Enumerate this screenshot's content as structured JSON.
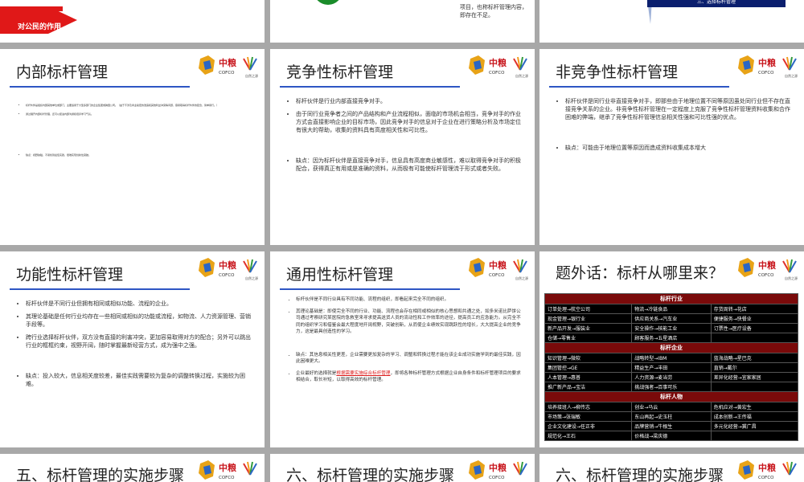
{
  "top_row": {
    "left_caption": "对公民的作用",
    "middle_text": "项目，也称标杆管理内容，即存在不足。",
    "right_box_text": "三、选择标杆管理"
  },
  "brand": {
    "cn": "中粮",
    "en": "COFCO",
    "sub": "自然之源"
  },
  "slides": {
    "s1": {
      "title": "内部标杆管理",
      "items": [
        "标杆伙伴是组织内部其他单位或部门，主要适用于大型多部门的企业集团或跨国公司。（由于不涉及商业秘密的泄露和其他利益冲突等问题，容易取得标杆伙伴的配合，简单易行。）",
        "通过展开内部标杆管理，还可以促进内部沟通和培养学习气氛。"
      ],
      "items2": [
        "缺点：视野狭隘，不易找到最佳实践，很难实现创新性突破。"
      ]
    },
    "s2": {
      "title": "竞争性标杆管理",
      "items": [
        "标杆伙伴是行业内部直接竞争对手。",
        "由于同行业竞争者之间的产品结构和产业流程相似，面临的市场机会相当，竞争对手的作业方式会直接影响企业的目标市场，因此竞争对手的信息对于企业在进行策略分析及市场定位有很大的帮助，收集的资料具有高度相关性和可比性。"
      ],
      "items2": [
        "缺点：因为标杆伙伴是直接竞争对手，信息具有高度商业敏感性，难以取得竞争对手的积极配合，获得真正有用或是准确的资料，从而极有可能使标杆管理流于形式或者失败。"
      ]
    },
    "s3": {
      "title": "非竞争性标杆管理",
      "items": [
        "标杆伙伴是同行业非直接竞争对手，即那些由于地理位置不同等原因虽处同行业但不存在直接竞争关系的企业。非竞争性标杆管理在一定程度上克服了竞争性标杆管理资料收集和合作困难的弊端，继承了竞争性标杆管理信息相关性强和可比性强的优点。"
      ],
      "items2": [
        "缺点：可能由于地理位置等原因而造成资料收集成本增大"
      ]
    },
    "s4": {
      "title": "功能性标杆管理",
      "items": [
        "标杆伙伴是不同行业但拥有相同或相似功能、流程的企业。",
        "其理论基础是任何行业均存在一些相同或相似的功能或流程，如物流、人力资源管理、营销手段等。",
        "跨行业选择标杆伙伴，双方没有直接的利害冲突，更加容易取得对方的配合；另外可以跳出行业的框框约束，视野开阔，随时掌握最新经营方式，成为强中之强。"
      ],
      "items2": [
        "缺点：投入较大，信息相关度较差，最佳实践需要较为复杂的调整转换过程，实施较为困难。"
      ]
    },
    "s5": {
      "title": "通用性标杆管理",
      "items": [
        "标杆伙伴是不同行业具有不同功能、流程的组织，即看起来完全不同的组织。",
        "其理论基础是：即使完全不同的行业、功能、流程也会存在相同或相似的核心思想和共通之处，如多米诺比萨饼公司通过考察研究某医院的急救室来寻求提高送货人员的流动性和工作效率的途径，提高员工的应急能力。从完全不同的组织学习和借鉴会最大程度地开阔视野，突破创新，从而使企业绩效实现跳跃性的增长，大大提高企业的竞争力，这是最具创造性的学习。"
      ],
      "items2": [
        "缺点：其信息相关性更差，企业需要更加复杂的学习、调整和转换过程才能在该企业成功实施学到的最佳实践，因此困难更大。"
      ],
      "last_pre": "企业最好的选择就是",
      "last_link": "根据需要实施综合标杆管理",
      "last_post": "，即将各种标杆管理方式根据企业自身条件和标杆管理项目的要求相结合，取长补短，以取得高效的标杆管理。"
    },
    "s6": {
      "title": "题外话：标杆从哪里来？",
      "table": {
        "sections": [
          {
            "header": "标杆行业",
            "rows": [
              [
                "订单处理→航空公司",
                "物流→冷链食品",
                "存货周转→花店"
              ],
              [
                "现金管理→银行业",
                "供应商关系→汽车业",
                "便捷服务→快餐业"
              ],
              [
                "新产品开发→服装业",
                "安全操作→核能工业",
                "订票性→医疗设备"
              ],
              [
                "仓储→零售业",
                "顾客服务→五星酒店",
                ""
              ]
            ]
          },
          {
            "header": "标杆企业",
            "rows": [
              [
                "知识管理→微软",
                "战略转型→IBM",
                "蓝海战略→星巴克"
              ],
              [
                "集团管控→GE",
                "精益生产→丰田",
                "直销→戴尔"
              ],
              [
                "人本管理→惠普",
                "人力资源→麦当劳",
                "差异化经营→宜家家居"
              ],
              [
                "推广新产品→宝洁",
                "挑战强者→百事可乐",
                ""
              ]
            ]
          },
          {
            "header": "标杆人物",
            "rows": [
              [
                "培养接班人→柳传志",
                "创业→马云",
                "危机应对→黄宏生"
              ],
              [
                "市场策→张瑞敏",
                "东山再起→史玉柱",
                "成本创新→王传福"
              ],
              [
                "企业文化建设→任正非",
                "品牌营销→牛根生",
                "多元化经营→冀广昌"
              ],
              [
                "规范化→王石",
                "价格战→梁庆德",
                ""
              ]
            ]
          }
        ]
      }
    },
    "b1": {
      "title": "五、标杆管理的实施步骤"
    },
    "b2": {
      "title": "六、标杆管理的实施步骤"
    },
    "b3": {
      "title": "六、标杆管理的实施步骤"
    }
  }
}
